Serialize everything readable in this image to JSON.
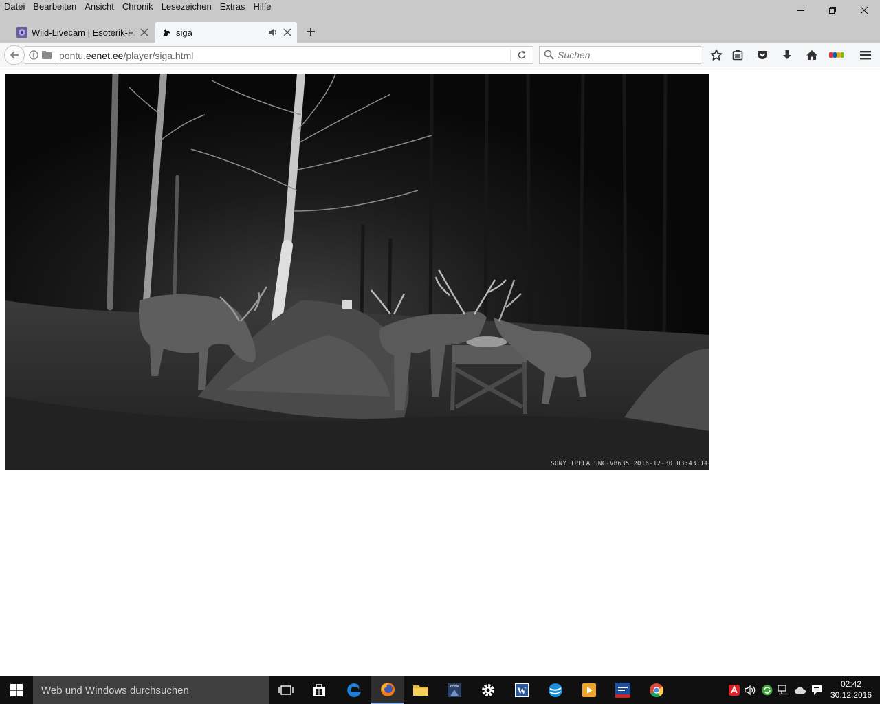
{
  "menu": [
    "Datei",
    "Bearbeiten",
    "Ansicht",
    "Chronik",
    "Lesezeichen",
    "Extras",
    "Hilfe"
  ],
  "tabs": [
    {
      "title": "Wild-Livecam | Esoterik-F…",
      "active": false
    },
    {
      "title": "siga",
      "active": true,
      "playing_audio": true
    }
  ],
  "url": {
    "prefix": "pontu.",
    "host": "eenet.ee",
    "path": "/player/siga.html"
  },
  "search": {
    "placeholder": "Suchen"
  },
  "video": {
    "overlay_text": "SONY IPELA SNC-VB635   2016-12-30 03:43:14"
  },
  "taskbar": {
    "search_placeholder": "Web und Windows durchsuchen",
    "time": "02:42",
    "date": "30.12.2016"
  },
  "colors": {
    "chrome": "#c9c9c9",
    "toolbar": "#f5f6f7",
    "taskbar": "#101010",
    "taskbar_search": "#3f3f3f"
  }
}
